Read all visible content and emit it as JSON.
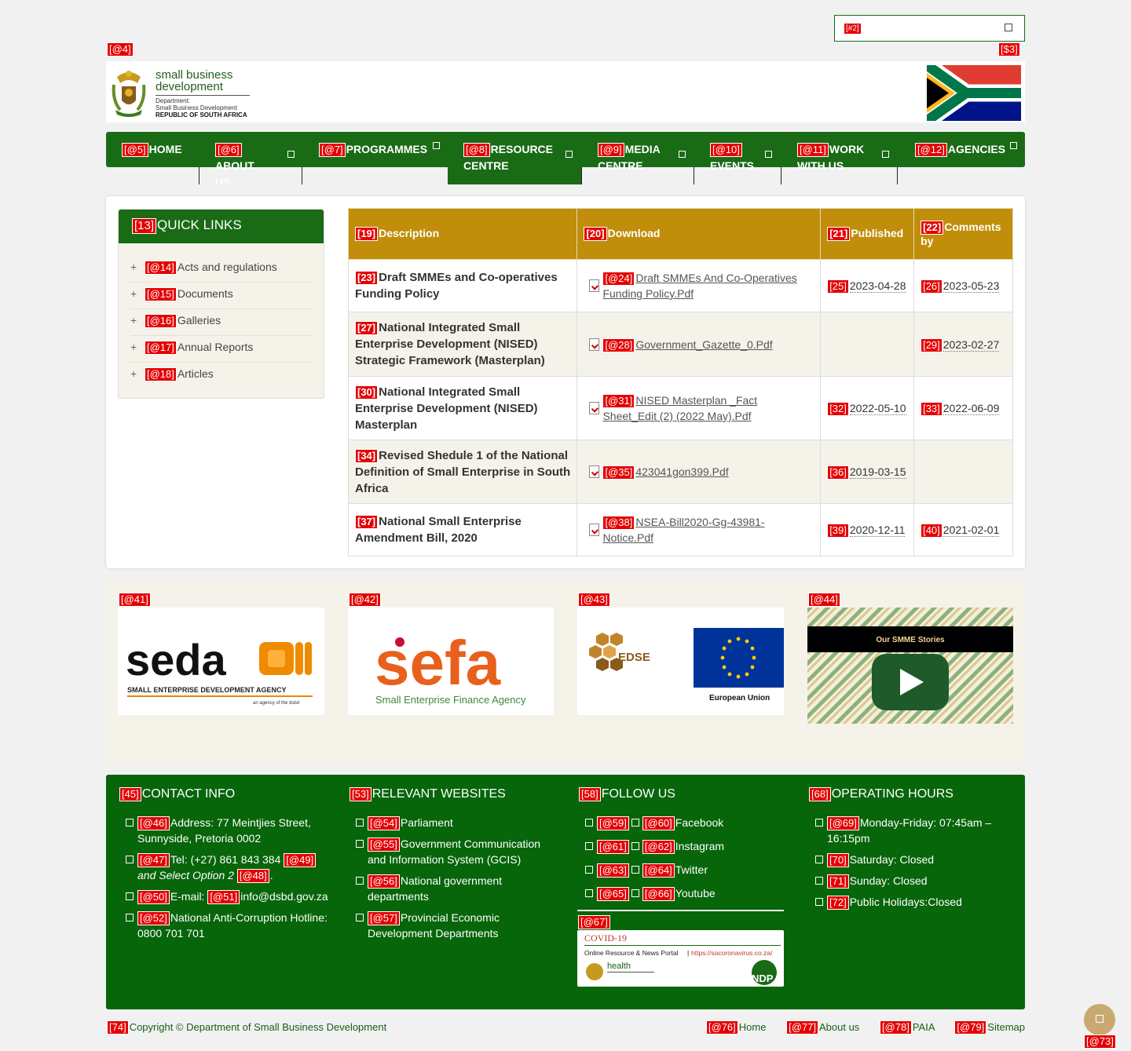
{
  "search": {
    "tag": "[#2]"
  },
  "tags": {
    "skip": "[@4]",
    "lang": "[$3]"
  },
  "logo": {
    "line1": "small business",
    "line2": "development",
    "line3": "Department:",
    "line4": "Small Business Development",
    "line5": "REPUBLIC OF SOUTH AFRICA"
  },
  "nav": [
    {
      "tag": "[@5]",
      "label": "HOME"
    },
    {
      "tag": "[@6]",
      "label": "ABOUT US"
    },
    {
      "tag": "[@7]",
      "label": "PROGRAMMES"
    },
    {
      "tag": "[@8]",
      "label": "RESOURCE CENTRE"
    },
    {
      "tag": "[@9]",
      "label": "MEDIA CENTRE"
    },
    {
      "tag": "[@10]",
      "label": "EVENTS"
    },
    {
      "tag": "[@11]",
      "label": "WORK WITH US"
    },
    {
      "tag": "[@12]",
      "label": "AGENCIES"
    }
  ],
  "quick_links": {
    "tag": "[13]",
    "title": "QUICK LINKS",
    "items": [
      {
        "tag": "[@14]",
        "label": "Acts and regulations"
      },
      {
        "tag": "[@15]",
        "label": "Documents"
      },
      {
        "tag": "[@16]",
        "label": "Galleries"
      },
      {
        "tag": "[@17]",
        "label": "Annual Reports"
      },
      {
        "tag": "[@18]",
        "label": "Articles"
      }
    ]
  },
  "table": {
    "headers": [
      {
        "tag": "[19]",
        "label": "Description"
      },
      {
        "tag": "[20]",
        "label": "Download"
      },
      {
        "tag": "[21]",
        "label": "Published"
      },
      {
        "tag": "[22]",
        "label": "Comments by"
      }
    ],
    "rows": [
      {
        "desc_tag": "[23]",
        "desc": "Draft SMMEs and Co-operatives Funding Policy",
        "file_tag": "[@24]",
        "file": "Draft SMMEs And Co-Operatives Funding Policy.Pdf",
        "pub_tag": "[25]",
        "published": "2023-04-28",
        "com_tag": "[26]",
        "comments": "2023-05-23"
      },
      {
        "desc_tag": "[27]",
        "desc": "National Integrated Small Enterprise Development (NISED) Strategic Framework (Masterplan)",
        "file_tag": "[@28]",
        "file": "Government_Gazette_0.Pdf",
        "pub_tag": "",
        "published": "",
        "com_tag": "[29]",
        "comments": "2023-02-27"
      },
      {
        "desc_tag": "[30]",
        "desc": "National Integrated Small Enterprise Development (NISED) Masterplan",
        "file_tag": "[@31]",
        "file": "NISED Masterplan _Fact Sheet_Edit (2) (2022 May).Pdf",
        "pub_tag": "[32]",
        "published": "2022-05-10",
        "com_tag": "[33]",
        "comments": "2022-06-09"
      },
      {
        "desc_tag": "[34]",
        "desc": "Revised Shedule 1 of the National Definition of Small Enterprise in South Africa",
        "file_tag": "[@35]",
        "file": "423041gon399.Pdf",
        "pub_tag": "[36]",
        "published": "2019-03-15",
        "com_tag": "",
        "comments": ""
      },
      {
        "desc_tag": "[37]",
        "desc": "National Small Enterprise Amendment Bill, 2020",
        "file_tag": "[@38]",
        "file": "NSEA-Bill2020-Gg-43981-Notice.Pdf",
        "pub_tag": "[39]",
        "published": "2020-12-11",
        "com_tag": "[40]",
        "comments": "2021-02-01"
      }
    ]
  },
  "partners": [
    {
      "tag": "[@41]",
      "name": "seda",
      "sub": "SMALL ENTERPRISE DEVELOPMENT AGENCY",
      "note": "an agency of the dsbd"
    },
    {
      "tag": "[@42]",
      "name": "sefa",
      "sub": "Small Enterprise Finance Agency"
    },
    {
      "tag": "[@43]",
      "name": "EDSE",
      "sub": "European Union"
    },
    {
      "tag": "[@44]",
      "name": "Our SMME Stories"
    }
  ],
  "footer": {
    "contact": {
      "tag": "[45]",
      "title": "CONTACT INFO",
      "address_tag": "[@46]",
      "address": "Address: 77 Meintjies Street, Sunnyside, Pretoria 0002",
      "tel_tag": "[@47]",
      "tel": "Tel: (+27) 861 843 384",
      "tel_tag2": "[@49]",
      "tel_extra": "and Select Option 2",
      "tel_tag3": "[@48]",
      "email_tag": "[@50]",
      "email_label": "E-mail:",
      "email_link_tag": "[@51]",
      "email": "info@dsbd.gov.za",
      "hotline_tag": "[@52]",
      "hotline": "National Anti-Corruption Hotline: 0800 701 701"
    },
    "websites": {
      "tag": "[53]",
      "title": "RELEVANT WEBSITES",
      "items": [
        {
          "tag": "[@54]",
          "label": "Parliament"
        },
        {
          "tag": "[@55]",
          "label": "Government Communication and Information System (GCIS)"
        },
        {
          "tag": "[@56]",
          "label": "National government departments"
        },
        {
          "tag": "[@57]",
          "label": "Provincial Economic Development Departments"
        }
      ]
    },
    "follow": {
      "tag": "[58]",
      "title": "FOLLOW US",
      "items": [
        {
          "tag1": "[@59]",
          "tag2": "[@60]",
          "label": "Facebook"
        },
        {
          "tag1": "[@61]",
          "tag2": "[@62]",
          "label": "Instagram"
        },
        {
          "tag1": "[@63]",
          "tag2": "[@64]",
          "label": "Twitter"
        },
        {
          "tag1": "[@65]",
          "tag2": "[@66]",
          "label": "Youtube"
        }
      ],
      "covid_tag": "[@67]",
      "covid_title": "COVID-19",
      "covid_portal": "Online Resource & News Portal",
      "covid_url": "https://sacoronavirus.co.za/",
      "covid_dept": "health",
      "covid_ndp": "NDP"
    },
    "hours": {
      "tag": "[68]",
      "title": "OPERATING HOURS",
      "items": [
        {
          "tag": "[@69]",
          "label": "Monday-Friday: 07:45am – 16:15pm"
        },
        {
          "tag": "[70]",
          "label": "Saturday: Closed"
        },
        {
          "tag": "[71]",
          "label": "Sunday: Closed"
        },
        {
          "tag": "[72]",
          "label": "Public Holidays:Closed"
        }
      ]
    }
  },
  "bottom": {
    "copy_tag": "[74]",
    "copyright": "Copyright © Department of Small Business Development",
    "links": [
      {
        "tag": "[@76]",
        "label": "Home"
      },
      {
        "tag": "[@77]",
        "label": "About us"
      },
      {
        "tag": "[@78]",
        "label": "PAIA"
      },
      {
        "tag": "[@79]",
        "label": "Sitemap"
      }
    ],
    "totop_tag": "[@73]"
  },
  "colors": {
    "green": "#1a6b16",
    "footer_green": "#07650a",
    "gold": "#c08e0a",
    "tag_red": "#e40000"
  }
}
